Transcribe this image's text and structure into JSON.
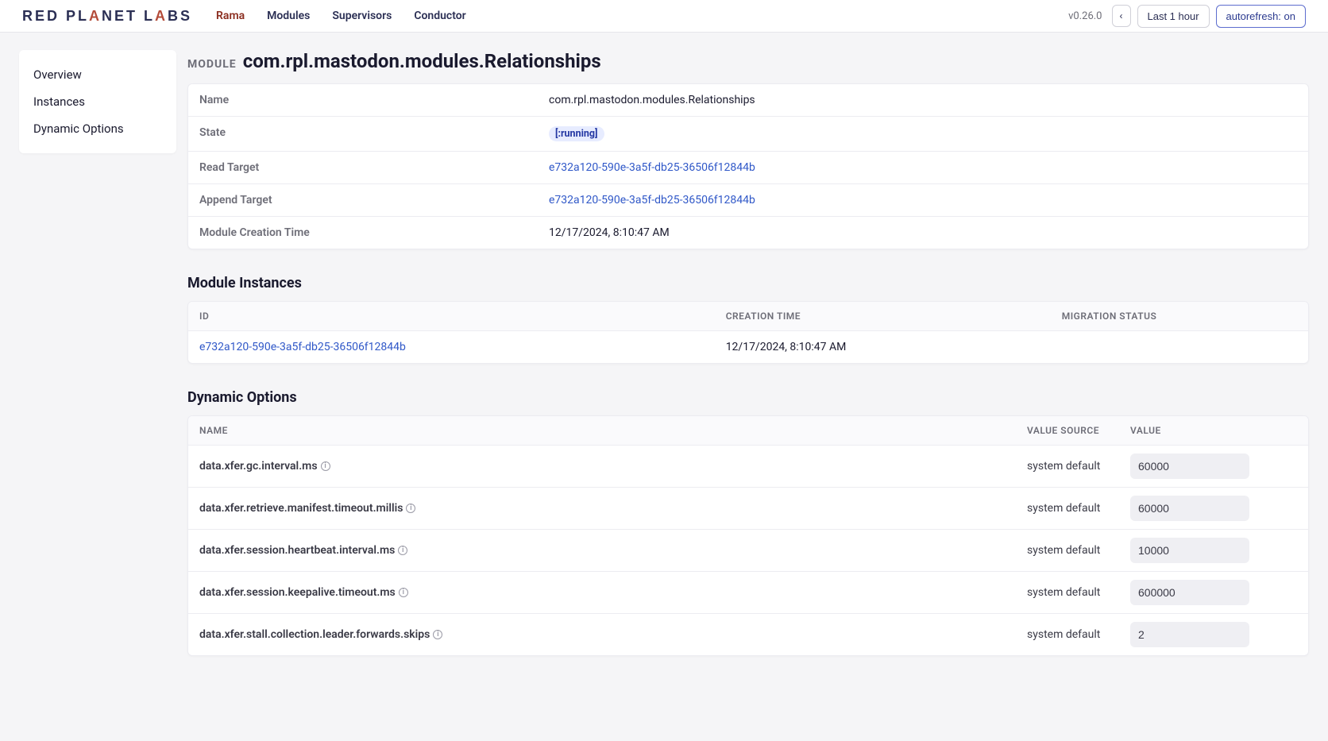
{
  "brand": {
    "text": "RED PLANET LABS"
  },
  "nav": {
    "items": [
      {
        "label": "Rama",
        "active": true
      },
      {
        "label": "Modules",
        "active": false
      },
      {
        "label": "Supervisors",
        "active": false
      },
      {
        "label": "Conductor",
        "active": false
      }
    ]
  },
  "topbar": {
    "version": "v0.26.0",
    "back_icon": "‹",
    "time_range": "Last 1 hour",
    "autorefresh": "autorefresh: on"
  },
  "sidebar": {
    "items": [
      {
        "label": "Overview"
      },
      {
        "label": "Instances"
      },
      {
        "label": "Dynamic Options"
      }
    ]
  },
  "header": {
    "kicker": "MODULE",
    "title": "com.rpl.mastodon.modules.Relationships"
  },
  "kv": {
    "rows": [
      {
        "k": "Name",
        "v": "com.rpl.mastodon.modules.Relationships",
        "type": "text"
      },
      {
        "k": "State",
        "v": "[:running]",
        "type": "badge"
      },
      {
        "k": "Read Target",
        "v": "e732a120-590e-3a5f-db25-36506f12844b",
        "type": "link"
      },
      {
        "k": "Append Target",
        "v": "e732a120-590e-3a5f-db25-36506f12844b",
        "type": "link"
      },
      {
        "k": "Module Creation Time",
        "v": "12/17/2024, 8:10:47 AM",
        "type": "text"
      }
    ]
  },
  "instances": {
    "heading": "Module Instances",
    "columns": [
      "ID",
      "CREATION TIME",
      "MIGRATION STATUS"
    ],
    "rows": [
      {
        "id": "e732a120-590e-3a5f-db25-36506f12844b",
        "created": "12/17/2024, 8:10:47 AM",
        "migration": ""
      }
    ]
  },
  "options": {
    "heading": "Dynamic Options",
    "columns": [
      "NAME",
      "VALUE SOURCE",
      "VALUE"
    ],
    "rows": [
      {
        "name": "data.xfer.gc.interval.ms",
        "source": "system default",
        "value": "60000"
      },
      {
        "name": "data.xfer.retrieve.manifest.timeout.millis",
        "source": "system default",
        "value": "60000"
      },
      {
        "name": "data.xfer.session.heartbeat.interval.ms",
        "source": "system default",
        "value": "10000"
      },
      {
        "name": "data.xfer.session.keepalive.timeout.ms",
        "source": "system default",
        "value": "600000"
      },
      {
        "name": "data.xfer.stall.collection.leader.forwards.skips",
        "source": "system default",
        "value": "2"
      }
    ]
  }
}
